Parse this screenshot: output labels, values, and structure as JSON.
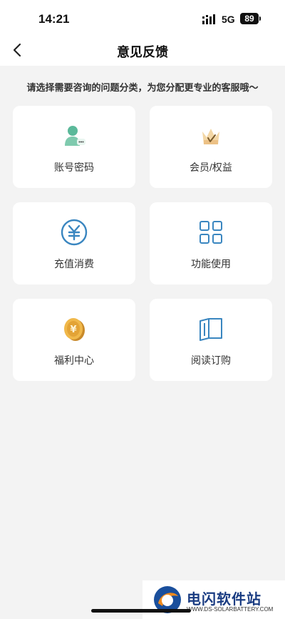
{
  "status_bar": {
    "time": "14:21",
    "network": "5G",
    "battery": "89",
    "signal_icon": "signal-bars-icon"
  },
  "header": {
    "title": "意见反馈",
    "back_icon": "chevron-left-icon"
  },
  "prompt": "请选择需要咨询的问题分类，为您分配更专业的客服哦～",
  "categories": [
    {
      "label": "账号密码",
      "icon": "account-user-icon",
      "color": "#5bb99a"
    },
    {
      "label": "会员/权益",
      "icon": "crown-icon",
      "color": "#e8b878"
    },
    {
      "label": "充值消费",
      "icon": "yuan-coin-icon",
      "color": "#3a86c0"
    },
    {
      "label": "功能使用",
      "icon": "grid-icon",
      "color": "#3a86c0"
    },
    {
      "label": "福利中心",
      "icon": "gold-coin-icon",
      "color": "#e0a23a"
    },
    {
      "label": "阅读订购",
      "icon": "open-book-icon",
      "color": "#3a86c0"
    }
  ],
  "watermark": {
    "title": "电闪软件站",
    "subtitle": "WWW.DS-SOLARBATTERY.COM"
  }
}
